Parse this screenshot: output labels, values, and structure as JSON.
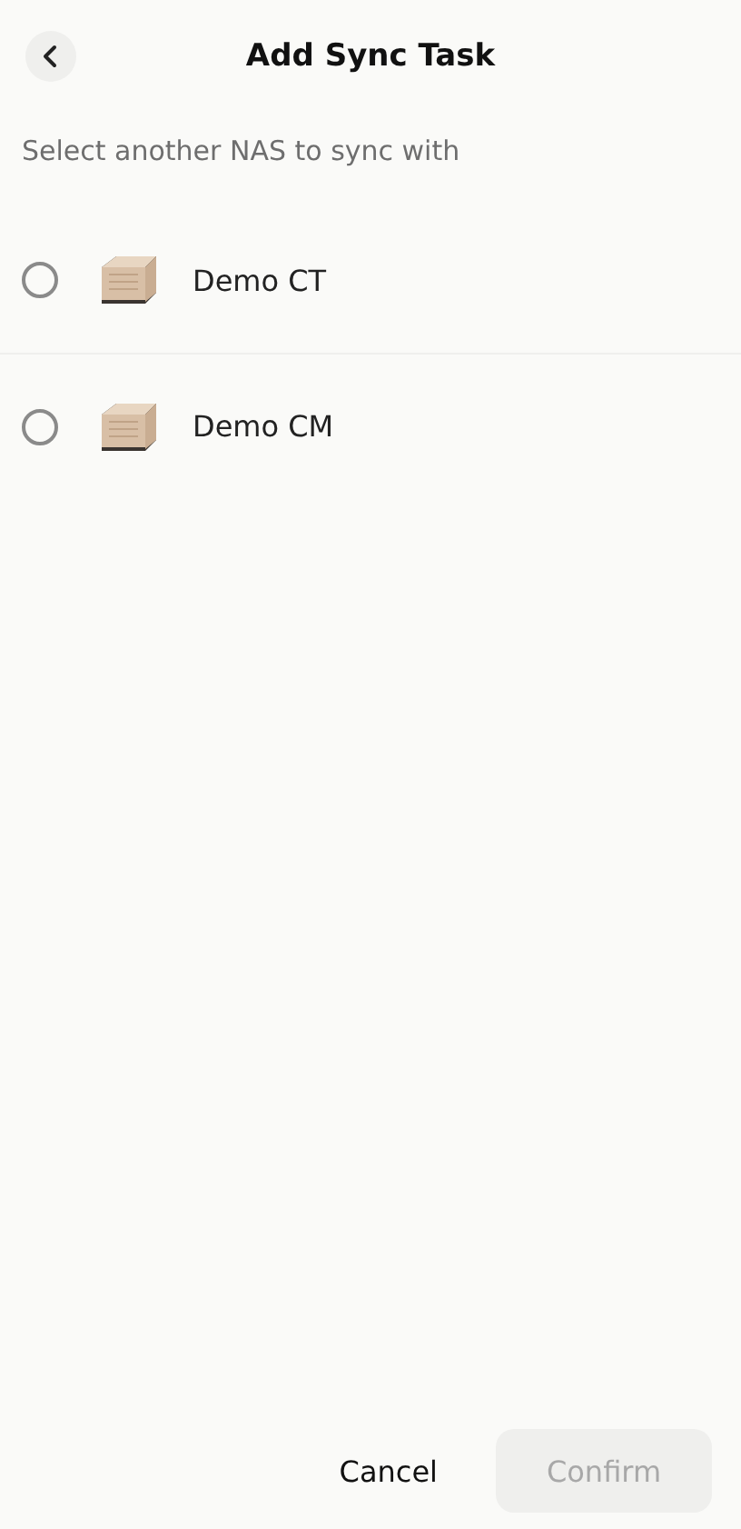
{
  "header": {
    "title": "Add Sync Task"
  },
  "subtitle": "Select another NAS to sync with",
  "devices": [
    {
      "name": "Demo CT",
      "selected": false
    },
    {
      "name": "Demo CM",
      "selected": false
    }
  ],
  "footer": {
    "cancel": "Cancel",
    "confirm": {
      "label": "Confirm",
      "disabled": true
    }
  }
}
